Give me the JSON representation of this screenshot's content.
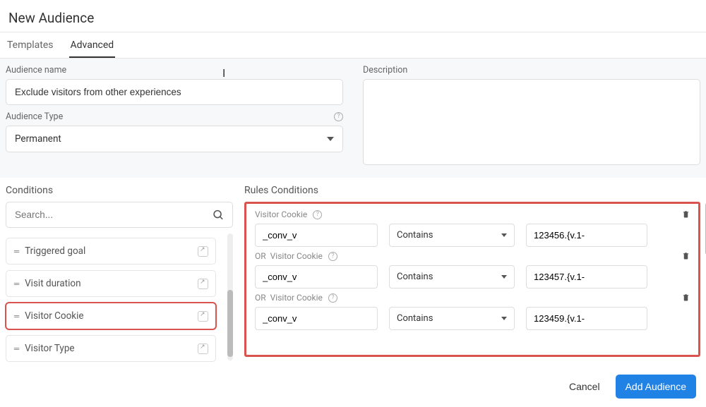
{
  "header": {
    "title": "New Audience"
  },
  "tabs": {
    "templates": "Templates",
    "advanced": "Advanced"
  },
  "form": {
    "name_label": "Audience name",
    "name_value": "Exclude visitors from other experiences",
    "type_label": "Audience Type",
    "type_value": "Permanent",
    "desc_label": "Description",
    "desc_value": ""
  },
  "conditions": {
    "title": "Conditions",
    "search_placeholder": "Search...",
    "items": [
      {
        "label": "Triggered goal",
        "highlight": false
      },
      {
        "label": "Visit duration",
        "highlight": false
      },
      {
        "label": "Visitor Cookie",
        "highlight": true
      },
      {
        "label": "Visitor Type",
        "highlight": false
      }
    ]
  },
  "rules": {
    "title": "Rules Conditions",
    "or_label": "OR",
    "rows": [
      {
        "type_label": "Visitor Cookie",
        "field": "_conv_v",
        "operator": "Contains",
        "value": "123456.{v.1-"
      },
      {
        "type_label": "Visitor Cookie",
        "field": "_conv_v",
        "operator": "Contains",
        "value": "123457.{v.1-"
      },
      {
        "type_label": "Visitor Cookie",
        "field": "_conv_v",
        "operator": "Contains",
        "value": "123459.{v.1-"
      }
    ]
  },
  "footer": {
    "cancel": "Cancel",
    "submit": "Add Audience"
  }
}
